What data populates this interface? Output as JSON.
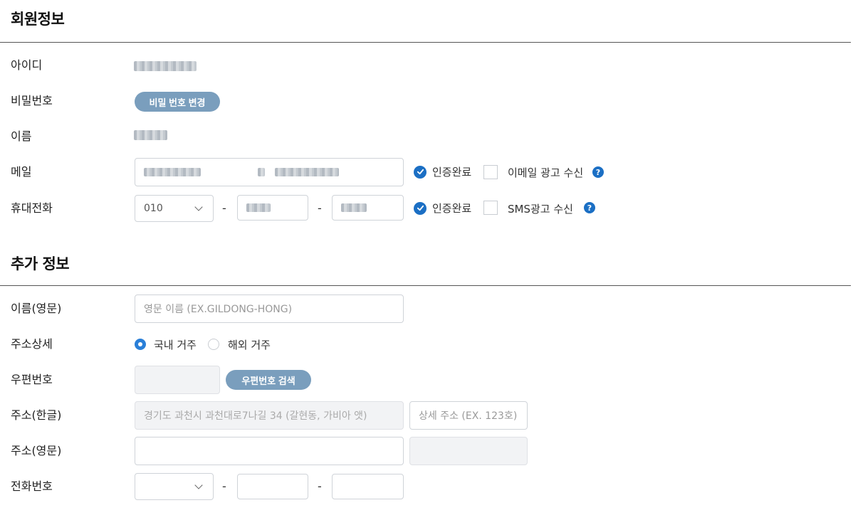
{
  "member": {
    "title": "회원정보",
    "id_label": "아이디",
    "password_label": "비밀번호",
    "change_password_button": "비밀 번호 변경",
    "name_label": "이름",
    "email_label": "메일",
    "email_verified": "인증완료",
    "email_ad_label": "이메일 광고 수신",
    "phone_label": "휴대전화",
    "phone_prefix": "010",
    "phone_verified": "인증완료",
    "sms_ad_label": "SMS광고 수신",
    "help_glyph": "?"
  },
  "extra": {
    "title": "추가 정보",
    "english_name_label": "이름(영문)",
    "english_name_placeholder": "영문 이름 (EX.GILDONG-HONG)",
    "address_type_label": "주소상세",
    "domestic_label": "국내 거주",
    "overseas_label": "해외 거주",
    "zipcode_label": "우편번호",
    "zipcode_search_button": "우편번호 검색",
    "address_kr_label": "주소(한글)",
    "address_kr_placeholder": "경기도 과천시 과천대로7나길 34 (갈현동, 가비아 앳)",
    "address_detail_placeholder": "상세 주소 (EX. 123호)",
    "address_en_label": "주소(영문)",
    "tel_label": "전화번호",
    "separator": "-"
  },
  "colors": {
    "accent": "#1b6fc4",
    "pill_button": "#7a9ebd",
    "radio_on": "#2a7fd8"
  }
}
